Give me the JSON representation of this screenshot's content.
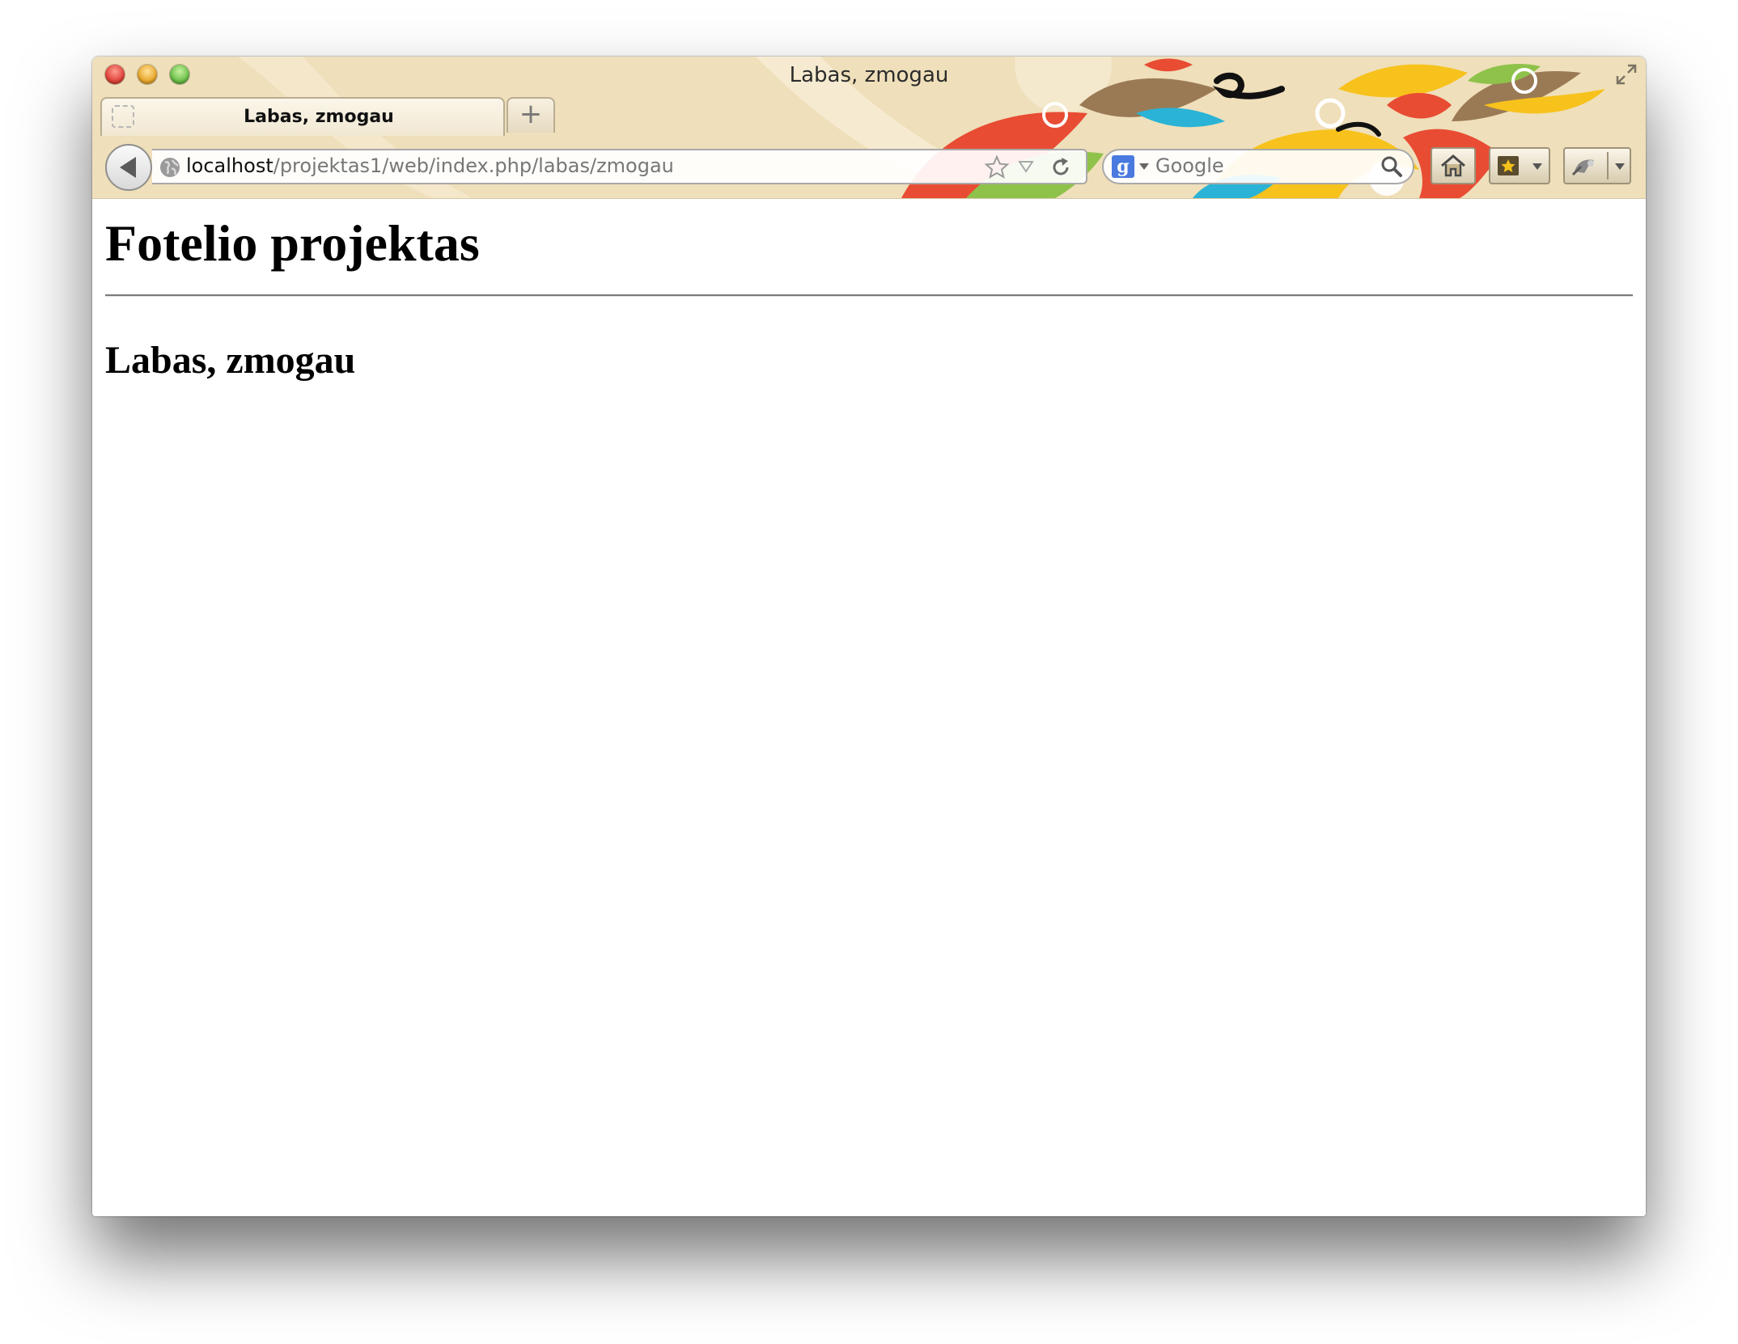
{
  "window": {
    "title": "Labas, zmogau"
  },
  "tabs": [
    {
      "label": "Labas, zmogau",
      "active": true
    }
  ],
  "new_tab_label": "+",
  "url_bar": {
    "host": "localhost",
    "path": "/projektas1/web/index.php/labas/zmogau"
  },
  "search_bar": {
    "engine_glyph": "g",
    "placeholder": "Google"
  },
  "page": {
    "heading": "Fotelio projektas",
    "subheading": "Labas, zmogau"
  },
  "icons": {
    "back": "back-arrow-icon",
    "site": "globe-icon",
    "bookmark": "star-icon",
    "reload": "reload-icon",
    "search": "magnifier-icon",
    "home": "home-icon",
    "bookmarks_menu": "bookmarks-icon",
    "addon": "addon-icon"
  },
  "colors": {
    "chrome_background": "#efdfba",
    "page_background": "#ffffff",
    "url_host": "#111111",
    "url_path": "#777777"
  }
}
